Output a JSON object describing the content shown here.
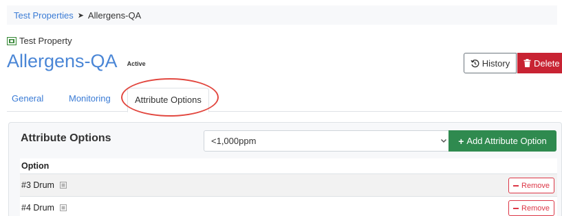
{
  "breadcrumb": {
    "parent": "Test Properties",
    "separator": "➤",
    "current": "Allergens-QA"
  },
  "header": {
    "type_label": "Test Property",
    "title": "Allergens-QA",
    "status": "Active",
    "history_label": "History",
    "delete_label": "Delete"
  },
  "tabs": {
    "general": "General",
    "monitoring": "Monitoring",
    "attribute_options": "Attribute Options"
  },
  "attribute_card": {
    "title": "Attribute Options",
    "selected_option": "<1,000ppm",
    "add_label": "Add Attribute Option",
    "column_header": "Option",
    "rows": [
      {
        "name": "#3 Drum",
        "remove_label": "Remove"
      },
      {
        "name": "#4 Drum",
        "remove_label": "Remove"
      }
    ]
  },
  "colors": {
    "link": "#3a7bd5",
    "delete": "#c82333",
    "add": "#2f8a4f",
    "remove": "#dc3545",
    "highlight": "#e2473f"
  }
}
